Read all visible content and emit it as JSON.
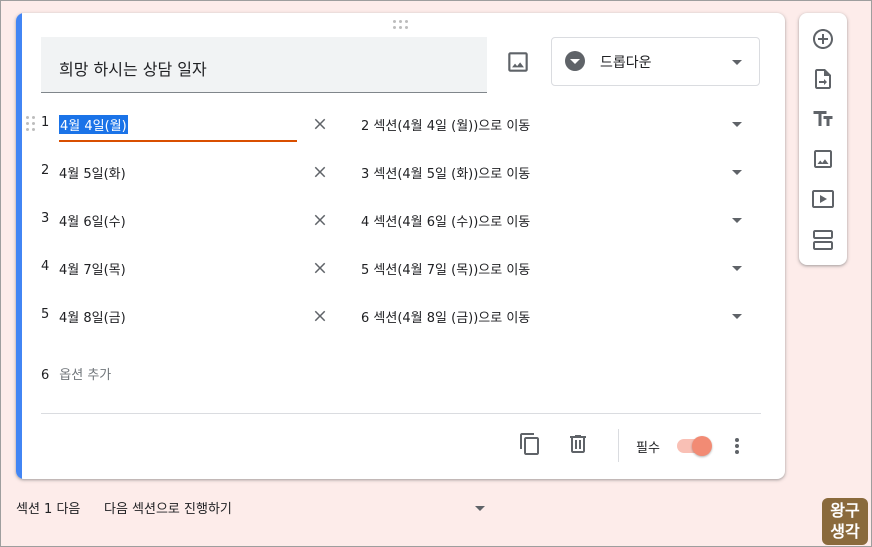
{
  "question": {
    "title": "희망 하시는 상담 일자",
    "type_label": "드롭다운",
    "options": [
      {
        "num": "1",
        "label": "4월 4일(월)",
        "goto": "2 섹션(4월 4일 (월))으로 이동"
      },
      {
        "num": "2",
        "label": "4월 5일(화)",
        "goto": "3 섹션(4월 5일 (화))으로 이동"
      },
      {
        "num": "3",
        "label": "4월 6일(수)",
        "goto": "4 섹션(4월 6일 (수))으로 이동"
      },
      {
        "num": "4",
        "label": "4월 7일(목)",
        "goto": "5 섹션(4월 7일 (목))으로 이동"
      },
      {
        "num": "5",
        "label": "4월 8일(금)",
        "goto": "6 섹션(4월 8일 (금))으로 이동"
      }
    ],
    "add_option": {
      "num": "6",
      "label": "옵션 추가"
    },
    "required_label": "필수",
    "required_on": true
  },
  "section_footer": {
    "label": "섹션 1 다음",
    "value": "다음 섹션으로 진행하기"
  },
  "logo": {
    "line1": "왕구",
    "line2": "생각"
  },
  "colors": {
    "accent": "#4285f4",
    "selection": "#1a73e8",
    "underline": "#d94f00",
    "toggle": "#f28b74"
  }
}
